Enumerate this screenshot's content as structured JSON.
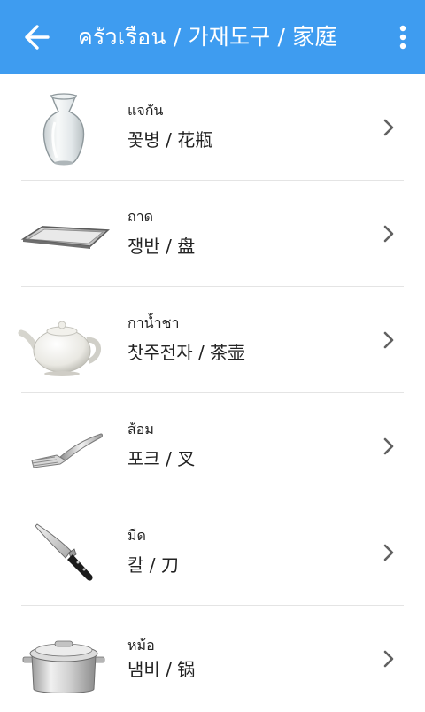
{
  "appbar": {
    "title": "ครัวเรือน / 가재도구 / 家庭",
    "back_icon": "arrow-left-icon",
    "menu_icon": "more-vertical-icon",
    "color": "#3e9cf0"
  },
  "items": [
    {
      "thai": "แจกัน",
      "translation": "꽃병   /   花瓶",
      "image": "vase"
    },
    {
      "thai": "ถาด",
      "translation": "쟁반   /   盘",
      "image": "tray"
    },
    {
      "thai": "กาน้ำชา",
      "translation": "찻주전자   /   茶壶",
      "image": "teapot"
    },
    {
      "thai": "ส้อม",
      "translation": "포크   /   叉",
      "image": "fork"
    },
    {
      "thai": "มีด",
      "translation": "칼   /   刀",
      "image": "knife"
    },
    {
      "thai": "หม้อ",
      "translation": "냄비   /   锅",
      "image": "pot"
    }
  ]
}
